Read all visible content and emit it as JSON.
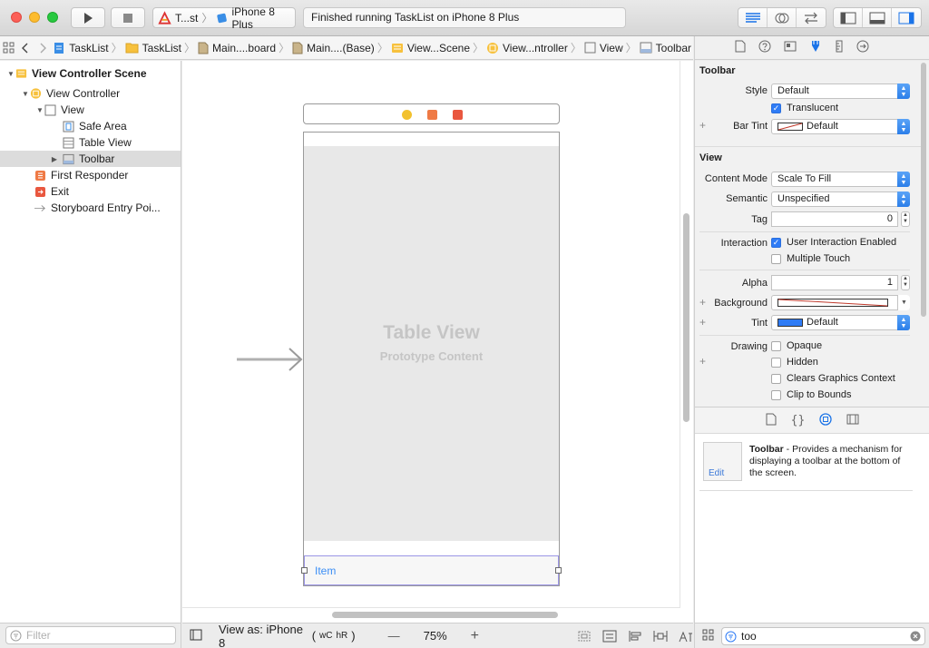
{
  "toolbar": {
    "scheme_target": "T...st",
    "scheme_device": "iPhone 8 Plus",
    "status_text": "Finished running TaskList on iPhone 8 Plus"
  },
  "jumpbar": {
    "crumbs": [
      "TaskList",
      "TaskList",
      "Main....board",
      "Main....(Base)",
      "View...Scene",
      "View...ntroller",
      "View",
      "Toolbar"
    ]
  },
  "outline": {
    "rows": [
      {
        "label": "View Controller Scene"
      },
      {
        "label": "View Controller"
      },
      {
        "label": "View"
      },
      {
        "label": "Safe Area"
      },
      {
        "label": "Table View"
      },
      {
        "label": "Toolbar"
      },
      {
        "label": "First Responder"
      },
      {
        "label": "Exit"
      },
      {
        "label": "Storyboard Entry Poi..."
      }
    ],
    "filter_placeholder": "Filter"
  },
  "canvas": {
    "table_title": "Table View",
    "table_subtitle": "Prototype Content",
    "toolbar_item": "Item"
  },
  "canvas_bottom": {
    "view_as": "View as: iPhone 8",
    "size_class_w": "wC",
    "size_class_h": "hR",
    "zoom_minus": "—",
    "zoom_level": "75%",
    "zoom_plus": "+"
  },
  "inspector": {
    "toolbar_section": {
      "title": "Toolbar",
      "style_label": "Style",
      "style_value": "Default",
      "translucent_label": "Translucent",
      "translucent_checked": true,
      "bar_tint_label": "Bar Tint",
      "bar_tint_value": "Default"
    },
    "view_section": {
      "title": "View",
      "content_mode_label": "Content Mode",
      "content_mode_value": "Scale To Fill",
      "semantic_label": "Semantic",
      "semantic_value": "Unspecified",
      "tag_label": "Tag",
      "tag_value": "0",
      "interaction_label": "Interaction",
      "user_interaction_label": "User Interaction Enabled",
      "user_interaction_checked": true,
      "multiple_touch_label": "Multiple Touch",
      "alpha_label": "Alpha",
      "alpha_value": "1",
      "background_label": "Background",
      "tint_label": "Tint",
      "tint_value": "Default",
      "tint_color": "#2f7cf6",
      "drawing_label": "Drawing",
      "opaque_label": "Opaque",
      "hidden_label": "Hidden",
      "clears_label": "Clears Graphics Context",
      "clip_label": "Clip to Bounds"
    }
  },
  "library": {
    "item_title": "Toolbar",
    "item_desc": " - Provides a mechanism for displaying a toolbar at the bottom of the screen.",
    "edit_label": "Edit",
    "filter_value": "too"
  },
  "colors": {
    "accent": "#1a73e8",
    "selection_outline": "#9b95e6"
  }
}
